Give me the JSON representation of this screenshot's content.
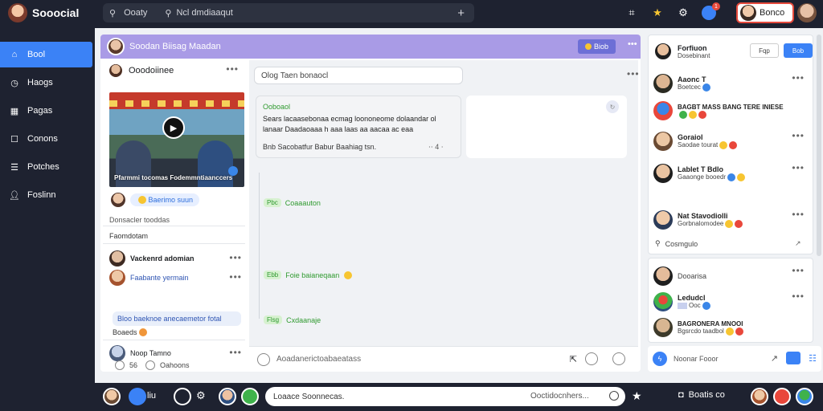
{
  "app": {
    "name": "Sooocial"
  },
  "search": {
    "placeholder": "Ooaty",
    "secondary": "Ncl dmdiaaqut"
  },
  "topbar": {
    "notification_count": "1",
    "profile_label": "Bonco"
  },
  "sidebar": {
    "items": [
      {
        "label": "Bool",
        "icon": "home-icon",
        "active": true
      },
      {
        "label": "Haogs",
        "icon": "clock-icon",
        "active": false
      },
      {
        "label": "Pagas",
        "icon": "store-icon",
        "active": false
      },
      {
        "label": "Conons",
        "icon": "calendar-icon",
        "active": false
      },
      {
        "label": "Potches",
        "icon": "list-icon",
        "active": false
      },
      {
        "label": "Foslinn",
        "icon": "person-icon",
        "active": false
      }
    ]
  },
  "feed_header": {
    "title": "Soodan Biisag Maadan",
    "button_label": "Biob"
  },
  "post": {
    "author": "Ooodoiinee",
    "video_caption": "Pfarmmi tocomas Fodemmntiaanccers",
    "reaction_pill": "Baerimo suun",
    "meta_line": "Donsacler tooddas",
    "section_label": "Faomdotam",
    "comments": [
      {
        "name": "Vackenrd adomian",
        "style": "bold"
      },
      {
        "name": "Faabante yermain",
        "style": "link"
      }
    ],
    "reply_box": "Bloo baeknoe anecaemetor fotal",
    "reply_footer": "Boaeds",
    "last_comment": "Noop Tamno"
  },
  "center": {
    "composer_placeholder": "Olog Taen bonaocl",
    "quoted_post": {
      "title": "Ooboaol",
      "body": "Sears lacaasebonaa ecmag loononeome dolaandar ol lanaar Daadaoaaa h aaa laas aa aacaa ac eaa",
      "footer": "Bnb Sacobatfur Babur Baahiag tsn.",
      "footer_count": "4"
    },
    "thread": [
      {
        "badge": "Pbc",
        "text": "Coaaauton"
      },
      {
        "badge": "Ebb",
        "text": "Foie baianeqaan"
      },
      {
        "badge": "Flsg",
        "text": "Cxdaanaje"
      }
    ],
    "input_placeholder": "Aoadanerictoabaeatass"
  },
  "footer_links": {
    "left": "56",
    "right": "Oahoons"
  },
  "friends": {
    "top": {
      "name": "Forfiuon",
      "sub": "Dosebinant",
      "filter_label": "Fqp",
      "add_label": "Bob"
    },
    "list": [
      {
        "name": "Aaonc T",
        "sub": "Boetcec"
      },
      {
        "name": "BAGBT MASS BANG TERE INIESE",
        "sub": ""
      },
      {
        "name": "Goraiol",
        "sub": "Saodae tourat"
      },
      {
        "name": "Lablet T Bdlo",
        "sub": "Gaaonge booedr"
      },
      {
        "name": "Nat Stavodiolli",
        "sub": "Gorbnalomodee"
      }
    ],
    "footer": "Cosmgulo"
  },
  "requests": {
    "list": [
      {
        "name": "Dooarisa",
        "sub": ""
      },
      {
        "name": "Ledudcl",
        "sub": "Ooc"
      },
      {
        "name": "BAGRONERA MNOOI",
        "sub": "Bgsrcdo taadbol"
      }
    ],
    "bar_label": "Noonar Fooor"
  },
  "bottombar": {
    "label": "liu",
    "search_placeholder": "Loaace Soonnecas.",
    "search_secondary": "Ooctidocnhers...",
    "right_label": "Boatis co"
  }
}
